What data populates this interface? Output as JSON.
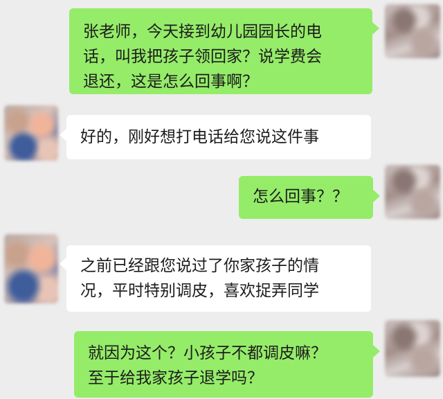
{
  "messages": [
    {
      "side": "right",
      "text": "张老师，今天接到幼儿园园长的电\n话，叫我把孩子领回家？说学费会\n退还，这是怎么回事啊？"
    },
    {
      "side": "left",
      "text": "好的，刚好想打电话给您说这件事"
    },
    {
      "side": "right",
      "text": "怎么回事？？"
    },
    {
      "side": "left",
      "text": "之前已经跟您说过了你家孩子的情\n况，平时特别调皮，喜欢捉弄同学"
    },
    {
      "side": "right",
      "text": "就因为这个？小孩子不都调皮嘛？\n至于给我家孩子退学吗？"
    }
  ],
  "colors": {
    "background": "#ededed",
    "sent_bubble": "#95ec69",
    "received_bubble": "#ffffff",
    "text": "#1c1c1c"
  },
  "icons": {
    "avatar_sender": "blurred-avatar-icon",
    "avatar_receiver": "blurred-avatar-icon"
  }
}
